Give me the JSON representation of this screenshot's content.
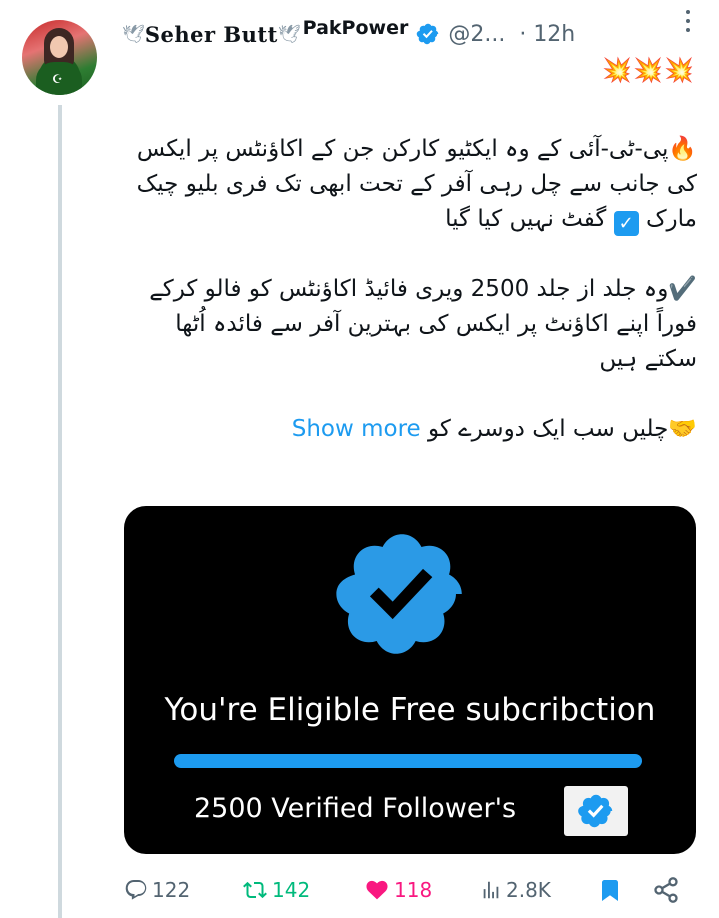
{
  "author": {
    "display_name": "Seher Butt",
    "org": "PakPower",
    "handle": "@2...",
    "time": "· 12h",
    "dove_left": "🕊",
    "dove_mid": "🕊"
  },
  "decorative_emoji": "💥💥💥",
  "tweet": {
    "line1": "🔥پی-ٹی-آئی کے وہ ایکٹیو کارکن جن کے اکاؤنٹس پر ایکس کی جانب سے چل رہی آفر کے تحت ابھی تک فری بلیو چیک مارک ",
    "line1_end": " گفٹ نہیں کیا گیا",
    "checkbox": "✓",
    "line2": "✔️وہ جلد از جلد 2500 ویری فائیڈ اکاؤنٹس کو فالو کرکے فوراً اپنے اکاؤنٹ پر ایکس کی بہترین آفر سے فائدہ اُٹھا سکتے ہیں",
    "line3": "🤝چلیں سب ایک دوسرے کو ",
    "show_more": "Show more"
  },
  "media": {
    "eligible_text": "You're Eligible Free subcribction",
    "followers_text": "2500 Verified Follower's",
    "progress": 1.0
  },
  "actions": {
    "replies": "122",
    "reposts": "142",
    "likes": "118",
    "views": "2.8K"
  },
  "colors": {
    "accent": "#1d9bf0",
    "repost": "#00ba7c",
    "like": "#f91880",
    "secondary_text": "#536471"
  },
  "icons": [
    "reply-icon",
    "repost-icon",
    "like-icon",
    "views-icon",
    "bookmark-icon",
    "share-icon",
    "verified-badge-icon",
    "more-icon"
  ]
}
